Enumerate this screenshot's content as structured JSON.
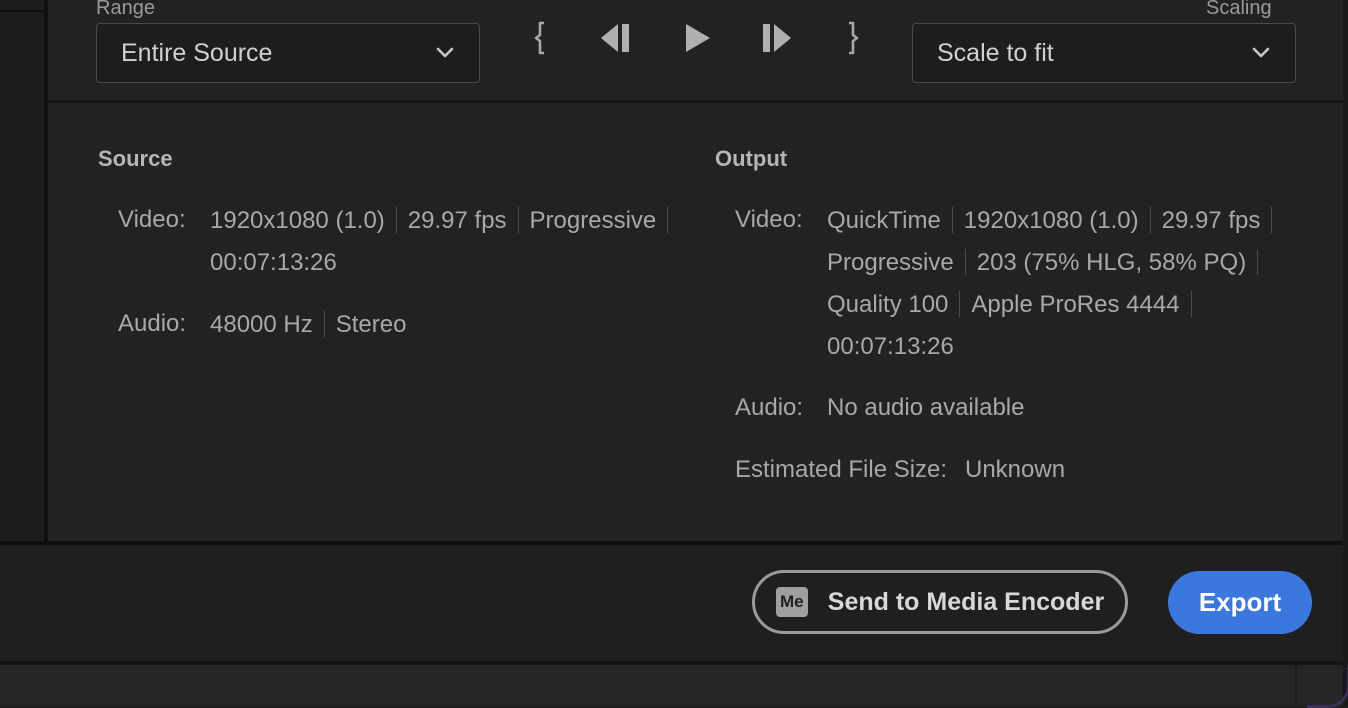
{
  "range": {
    "label": "Range",
    "value": "Entire Source"
  },
  "scaling": {
    "label": "Scaling",
    "value": "Scale to fit"
  },
  "transport": {
    "icons": [
      "mark-in-icon",
      "step-back-icon",
      "play-icon",
      "step-forward-icon",
      "mark-out-icon"
    ]
  },
  "source": {
    "title": "Source",
    "video_label": "Video:",
    "video_parts": [
      "1920x1080 (1.0)",
      "29.97 fps",
      "Progressive"
    ],
    "video_duration": "00:07:13:26",
    "audio_label": "Audio:",
    "audio_parts": [
      "48000 Hz",
      "Stereo"
    ]
  },
  "output": {
    "title": "Output",
    "video_label": "Video:",
    "video_line1": [
      "QuickTime",
      "1920x1080 (1.0)",
      "29.97 fps"
    ],
    "video_line2": [
      "Progressive",
      "203 (75% HLG, 58% PQ)"
    ],
    "video_line3": [
      "Quality 100",
      "Apple ProRes 4444"
    ],
    "video_duration": "00:07:13:26",
    "audio_label": "Audio:",
    "audio_value": "No audio available",
    "size_label": "Estimated File Size:",
    "size_value": "Unknown"
  },
  "actions": {
    "encoder_icon": "Me",
    "encoder_label": "Send to Media Encoder",
    "export_label": "Export"
  },
  "colors": {
    "accent": "#3a78e0",
    "background": "#222222"
  }
}
